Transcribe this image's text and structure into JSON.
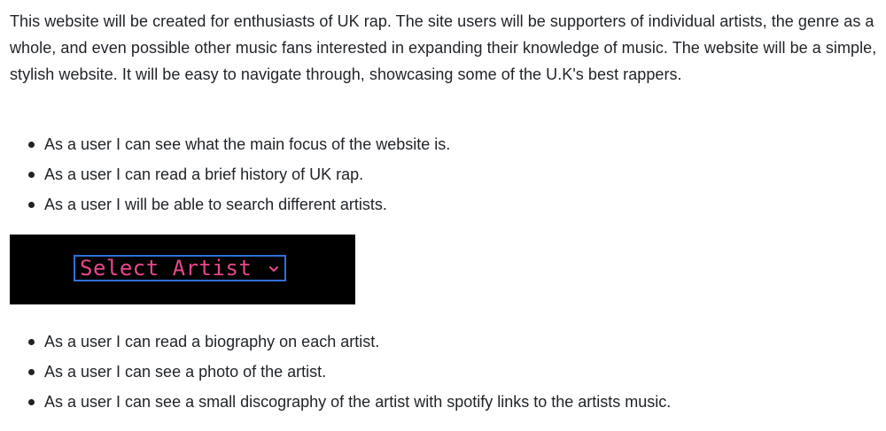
{
  "intro": {
    "paragraph": "This website will be created for enthusiasts of UK rap. The site users will be supporters of individual artists, the genre as a whole, and even possible other music fans interested in expanding their knowledge of music. The website will be a simple, stylish website. It will be easy to navigate through, showcasing some of the U.K's best rappers."
  },
  "stories_top": [
    "As a user I can see what the main focus of the website is.",
    "As a user I can read a brief history of UK rap.",
    "As a user I will be able to search different artists."
  ],
  "select_preview": {
    "label": "Select Artist",
    "text_color": "#e8468c",
    "border_color": "#2f6fd9",
    "background": "#000000",
    "icon": "chevron-down-icon"
  },
  "stories_bottom": [
    "As a user I can read a biography on each artist.",
    "As a user I can see a photo of the artist.",
    "As a user I can see a small discography of the artist with spotify links to the artists music."
  ]
}
